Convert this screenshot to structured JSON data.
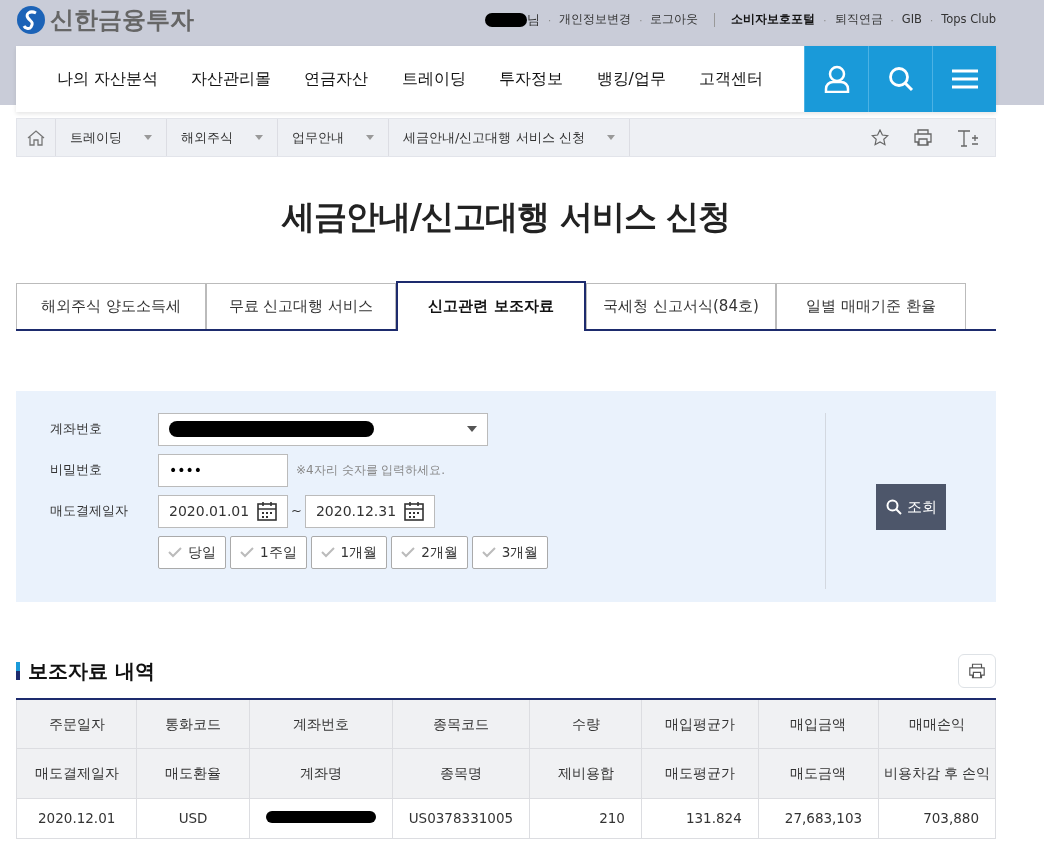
{
  "header": {
    "logo_text": "신한금융투자",
    "separator": "·",
    "user": {
      "redacted": true,
      "suffix": "님"
    },
    "util_links": [
      {
        "label": "개인정보변경",
        "bold": false
      },
      {
        "label": "로그아웃",
        "bold": false
      }
    ],
    "util_links_2": [
      {
        "label": "소비자보호포털",
        "bold": true
      },
      {
        "label": "퇴직연금",
        "bold": false
      },
      {
        "label": "GIB",
        "bold": false
      },
      {
        "label": "Tops Club",
        "bold": false
      }
    ]
  },
  "nav": {
    "items": [
      "나의 자산분석",
      "자산관리몰",
      "연금자산",
      "트레이딩",
      "투자정보",
      "뱅킹/업무",
      "고객센터"
    ]
  },
  "breadcrumb": [
    "트레이딩",
    "해외주식",
    "업무안내",
    "세금안내/신고대행 서비스 신청"
  ],
  "page_title": "세금안내/신고대행 서비스 신청",
  "tabs": [
    {
      "label": "해외주식 양도소득세",
      "selected": false
    },
    {
      "label": "무료 신고대행 서비스",
      "selected": false
    },
    {
      "label": "신고관련 보조자료",
      "selected": true
    },
    {
      "label": "국세청 신고서식(84호)",
      "selected": false
    },
    {
      "label": "일별 매매기준 환율",
      "selected": false
    }
  ],
  "form": {
    "account": {
      "label": "계좌번호",
      "redacted": true
    },
    "password": {
      "label": "비밀번호",
      "value": "••••",
      "hint": "※4자리 숫자를 입력하세요."
    },
    "date": {
      "label": "매도결제일자",
      "from": "2020.01.01",
      "separator": "~",
      "to": "2020.12.31"
    },
    "periods": [
      "당일",
      "1주일",
      "1개월",
      "2개월",
      "3개월"
    ],
    "search_button": "조회"
  },
  "section_title": "보조자료 내역",
  "table": {
    "header_rows": [
      [
        "주문일자",
        "통화코드",
        "계좌번호",
        "종목코드",
        "수량",
        "매입평균가",
        "매입금액",
        "매매손익"
      ],
      [
        "매도결제일자",
        "매도환율",
        "계좌명",
        "종목명",
        "제비용합",
        "매도평균가",
        "매도금액",
        "비용차감 후 손익"
      ]
    ],
    "rows": [
      {
        "cells": [
          "2020.12.01",
          "USD",
          null,
          "US0378331005",
          "210",
          "131.824",
          "27,683,103",
          "703,880"
        ]
      }
    ]
  }
}
